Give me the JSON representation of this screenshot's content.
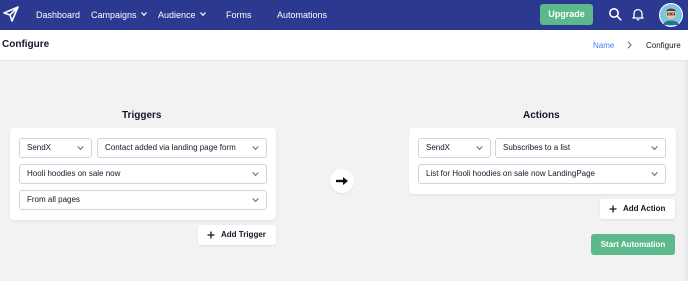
{
  "topbar": {
    "nav": {
      "dashboard": "Dashboard",
      "campaigns": "Campaigns",
      "audience": "Audience",
      "forms": "Forms",
      "automations": "Automations"
    },
    "upgrade_label": "Upgrade",
    "icons": {
      "logo": "paper-plane-icon",
      "search": "search-icon",
      "notifications": "bell-icon",
      "avatar": "user-avatar"
    },
    "colors": {
      "background": "#2b3990",
      "upgrade": "#5bb98b"
    }
  },
  "header": {
    "title": "Configure",
    "breadcrumb": {
      "link": "Name",
      "current": "Configure"
    }
  },
  "triggers": {
    "title": "Triggers",
    "app_select": "SendX",
    "event_select": "Contact added via landing page form",
    "form_select": "Hooli hoodies on sale now",
    "pages_select": "From all pages",
    "add_label": "Add Trigger"
  },
  "actions": {
    "title": "Actions",
    "app_select": "SendX",
    "action_select": "Subscribes to a list",
    "list_select": "List for Hooli hoodies on sale now LandingPage",
    "add_label": "Add Action"
  },
  "start_label": "Start Automation",
  "connector_icon": "arrow-right-icon"
}
